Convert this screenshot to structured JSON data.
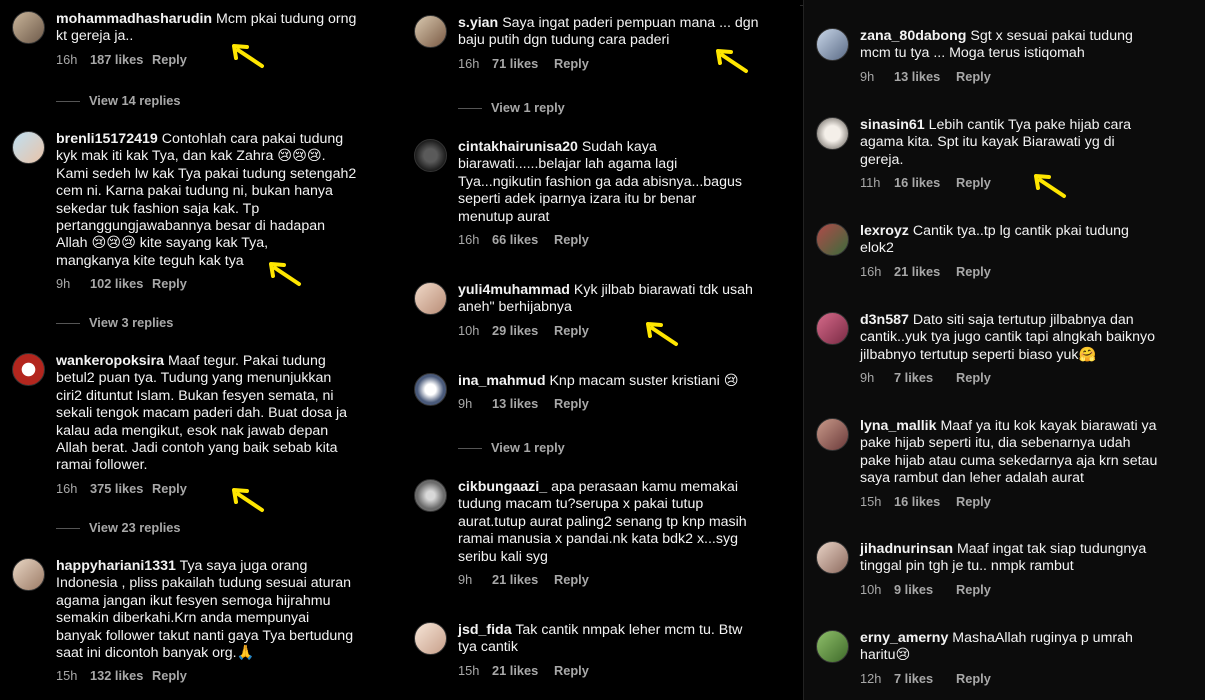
{
  "col1": {
    "comments": [
      {
        "user": "mohammadhasharudin",
        "text": "Mcm pkai tudung orng\nkt  gereja ja..",
        "time": "16h",
        "likes": "187 likes",
        "reply": "Reply",
        "view_replies": "View 14 replies"
      },
      {
        "user": "brenli15172419",
        "text": "Contohlah cara pakai tudung\nkyk mak iti kak Tya, dan kak Zahra 😢😢😢.\nKami sedeh lw kak Tya pakai tudung setengah2\ncem ni. Karna pakai tudung ni, bukan hanya\nsekedar tuk fashion saja kak. Tp\npertanggungjawabannya besar di hadapan\nAllah 😢😢😢 kite sayang kak Tya,\nmangkanya kite teguh kak tya",
        "time": "9h",
        "likes": "102 likes",
        "reply": "Reply",
        "view_replies": "View 3 replies"
      },
      {
        "user": "wankeropoksira",
        "text": "Maaf tegur. Pakai tudung\nbetul2 puan tya. Tudung yang menunjukkan\nciri2 dituntut Islam. Bukan fesyen semata, ni\nsekali tengok macam paderi dah. Buat dosa ja\nkalau ada mengikut, esok nak jawab depan\nAllah berat. Jadi contoh yang baik sebab kita\nramai follower.",
        "time": "16h",
        "likes": "375 likes",
        "reply": "Reply",
        "view_replies": "View 23 replies"
      },
      {
        "user": "happyhariani1331",
        "text": "Tya saya juga orang\nIndonesia , pliss pakailah tudung sesuai aturan\nagama jangan ikut fesyen semoga hijrahmu\nsemakin diberkahi.Krn anda mempunyai\nbanyak follower takut nanti gaya Tya bertudung\nsaat ini dicontoh banyak org.🙏",
        "time": "15h",
        "likes": "132 likes",
        "reply": "Reply"
      }
    ]
  },
  "col2": {
    "comments": [
      {
        "user": "s.yian",
        "text": "Saya ingat paderi pempuan mana ... dgn\nbaju putih dgn tudung cara paderi",
        "time": "16h",
        "likes": "71 likes",
        "reply": "Reply",
        "view_replies": "View 1 reply"
      },
      {
        "user": "cintakhairunisa20",
        "text": "Sudah kaya\nbiarawati......belajar lah agama lagi\nTya...ngikutin fashion  ga ada abisnya...bagus\nseperti adek iparnya izara itu br benar\nmenutup aurat",
        "time": "16h",
        "likes": "66 likes",
        "reply": "Reply"
      },
      {
        "user": "yuli4muhammad",
        "text": "Kyk jilbab biarawati tdk usah\naneh\" berhijabnya",
        "time": "10h",
        "likes": "29 likes",
        "reply": "Reply"
      },
      {
        "user": "ina_mahmud",
        "text": "Knp macam suster kristiani 😢",
        "time": "9h",
        "likes": "13 likes",
        "reply": "Reply",
        "view_replies": "View 1 reply"
      },
      {
        "user": "cikbungaazi_",
        "text": "apa perasaan kamu memakai\ntudung macam tu?serupa x pakai tutup\naurat.tutup aurat paling2 senang tp knp masih\nramai manusia x pandai.nk kata bdk2 x...syg\nseribu kali syg",
        "time": "9h",
        "likes": "21 likes",
        "reply": "Reply"
      },
      {
        "user": "jsd_fida",
        "text": "Tak cantik nmpak leher mcm tu. Btw\ntya cantik",
        "time": "15h",
        "likes": "21 likes",
        "reply": "Reply"
      }
    ]
  },
  "col3": {
    "comments": [
      {
        "user": "zana_80dabong",
        "text": "Sgt x sesuai pakai tudung\nmcm tu tya ... Moga terus istiqomah",
        "time": "9h",
        "likes": "13 likes",
        "reply": "Reply"
      },
      {
        "user": "sinasin61",
        "text": "Lebih cantik Tya pake hijab cara\nagama kita. Spt itu kayak Biarawati yg di\ngereja.",
        "time": "11h",
        "likes": "16 likes",
        "reply": "Reply"
      },
      {
        "user": "lexroyz",
        "text": "Cantik tya..tp lg cantik pkai tudung\nelok2",
        "time": "16h",
        "likes": "21 likes",
        "reply": "Reply"
      },
      {
        "user": "d3n587",
        "text": "Dato siti saja tertutup jilbabnya dan\ncantik..yuk tya jugo cantik tapi alngkah baiknyo\njilbabnyo tertutup seperti biaso yuk🤗",
        "time": "9h",
        "likes": "7 likes",
        "reply": "Reply"
      },
      {
        "user": "lyna_mallik",
        "text": "Maaf ya itu kok kayak biarawati ya\npake hijab seperti itu, dia sebenarnya udah\npake hijab atau cuma sekedarnya aja krn setau\nsaya rambut dan leher adalah aurat",
        "time": "15h",
        "likes": "16 likes",
        "reply": "Reply"
      },
      {
        "user": "jihadnurinsan",
        "text": "Maaf ingat tak siap tudungnya\ntinggal pin tgh je tu.. nmpk rambut",
        "time": "10h",
        "likes": "9 likes",
        "reply": "Reply"
      },
      {
        "user": "erny_amerny",
        "text": "MashaAllah ruginya p umrah\nharitu😢",
        "time": "12h",
        "likes": "7 likes",
        "reply": "Reply"
      }
    ]
  },
  "colors": {
    "arrow": "#FFE600",
    "meta": "#A8A8A8",
    "background": "#000000"
  }
}
